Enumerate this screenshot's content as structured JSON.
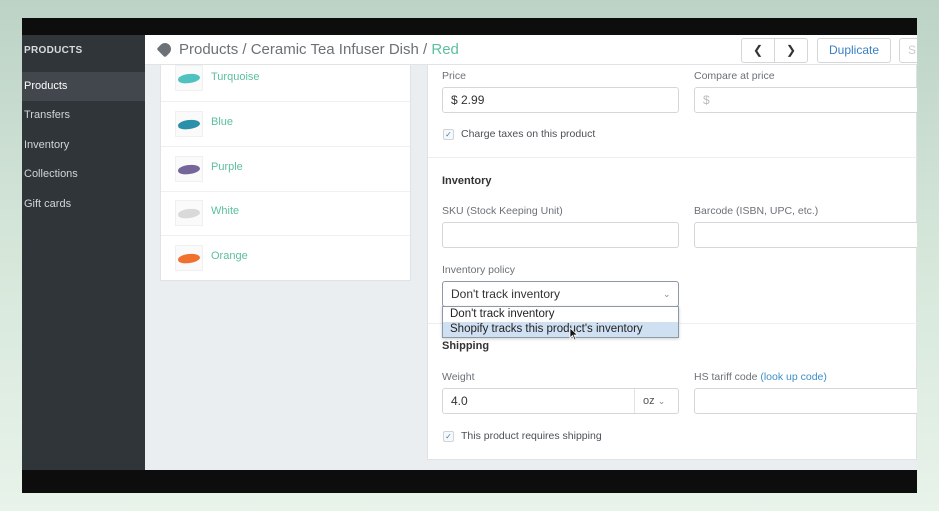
{
  "sidebar": {
    "heading": "PRODUCTS",
    "items": [
      {
        "label": "Products",
        "active": true
      },
      {
        "label": "Transfers"
      },
      {
        "label": "Inventory"
      },
      {
        "label": "Collections"
      },
      {
        "label": "Gift cards"
      }
    ]
  },
  "header": {
    "breadcrumb_root": "Products",
    "separator": " / ",
    "product": "Ceramic Tea Infuser Dish",
    "current": "Red",
    "icon": "tag-icon",
    "prev_icon": "chevron-left-icon",
    "next_icon": "chevron-right-icon",
    "duplicate_label": "Duplicate",
    "partial_button_label": "S"
  },
  "variants": [
    {
      "name": "Turquoise",
      "color": "#4fc1c0"
    },
    {
      "name": "Blue",
      "color": "#2a8fa8"
    },
    {
      "name": "Purple",
      "color": "#75659b"
    },
    {
      "name": "White",
      "color": "#d9d9d9"
    },
    {
      "name": "Orange",
      "color": "#f0702e"
    }
  ],
  "pricing": {
    "price_label": "Price",
    "price_value": "$ 2.99",
    "compare_label": "Compare at price",
    "compare_placeholder": "$",
    "charge_taxes_label": "Charge taxes on this product",
    "charge_taxes_checked": true
  },
  "inventory": {
    "heading": "Inventory",
    "sku_label": "SKU (Stock Keeping Unit)",
    "sku_value": "",
    "barcode_label": "Barcode (ISBN, UPC, etc.)",
    "barcode_value": "",
    "policy_label": "Inventory policy",
    "policy_value": "Don't track inventory",
    "policy_options": [
      "Don't track inventory",
      "Shopify tracks this product's inventory"
    ],
    "highlighted_option": 1
  },
  "shipping": {
    "heading": "Shipping",
    "weight_label": "Weight",
    "weight_value": "4.0",
    "weight_unit": "oz",
    "hs_label": "HS tariff code",
    "hs_link": "(look up code)",
    "hs_value": "",
    "requires_shipping_label": "This product requires shipping",
    "requires_shipping_checked": true
  },
  "colors": {
    "accent": "#5cbf9f",
    "link": "#3a7fc1",
    "sidebar": "#30353a"
  }
}
